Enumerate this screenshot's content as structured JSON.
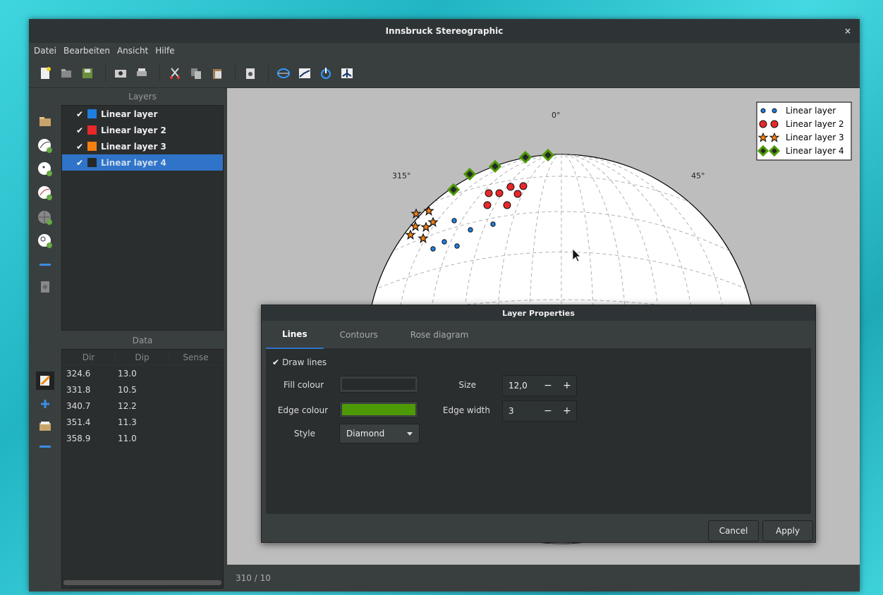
{
  "window": {
    "title": "Innsbruck Stereographic",
    "close": "×"
  },
  "menu": [
    "Datei",
    "Bearbeiten",
    "Ansicht",
    "Hilfe"
  ],
  "layers_panel": {
    "title": "Layers",
    "items": [
      {
        "label": "Linear layer",
        "color": "#1e7fe0"
      },
      {
        "label": "Linear layer 2",
        "color": "#e8282a"
      },
      {
        "label": "Linear layer 3",
        "color": "#f57f10"
      },
      {
        "label": "Linear layer 4",
        "color": "#25282a"
      }
    ]
  },
  "data_panel": {
    "title": "Data",
    "columns": [
      "Dir",
      "Dip",
      "Sense"
    ],
    "rows": [
      [
        "324.6",
        "13.0",
        ""
      ],
      [
        "331.8",
        "10.5",
        ""
      ],
      [
        "340.7",
        "12.2",
        ""
      ],
      [
        "351.4",
        "11.3",
        ""
      ],
      [
        "358.9",
        "11.0",
        ""
      ]
    ]
  },
  "plot": {
    "labels": {
      "north": "0°",
      "nw": "315°",
      "ne": "45°"
    },
    "legend": [
      "Linear layer",
      "Linear layer 2",
      "Linear layer 3",
      "Linear layer 4"
    ]
  },
  "status": "310 / 10",
  "dialog": {
    "title": "Layer Properties",
    "tabs": [
      "Lines",
      "Contours",
      "Rose diagram"
    ],
    "draw_lines": "Draw lines",
    "fill_label": "Fill colour",
    "fill_color": "#272b2c",
    "edge_label": "Edge colour",
    "edge_color": "#4e9a06",
    "style_label": "Style",
    "style_value": "Diamond",
    "size_label": "Size",
    "size_value": "12,0",
    "edgew_label": "Edge width",
    "edgew_value": "3",
    "minus": "−",
    "plus": "+",
    "cancel": "Cancel",
    "apply": "Apply"
  }
}
